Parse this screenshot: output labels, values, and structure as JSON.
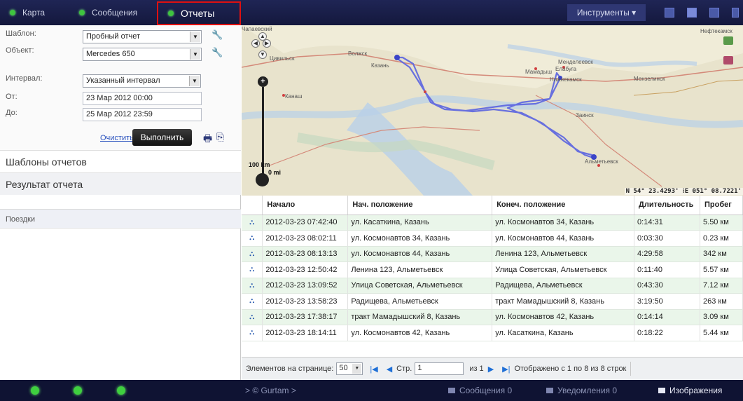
{
  "topbar": {
    "tabs": [
      {
        "label": "Карта"
      },
      {
        "label": "Сообщения"
      },
      {
        "label": "Отчеты"
      }
    ],
    "tools_label": "Инструменты ▾"
  },
  "form": {
    "template_label": "Шаблон:",
    "template_value": "Пробный отчет",
    "object_label": "Объект:",
    "object_value": "Mercedes 650",
    "interval_label": "Интервал:",
    "interval_value": "Указанный интервал",
    "from_label": "От:",
    "from_value": "23 Мар 2012 00:00",
    "to_label": "До:",
    "to_value": "25 Мар 2012 23:59",
    "clear_label": "Очистить",
    "run_label": "Выполнить"
  },
  "sections": {
    "templates": "Шаблоны отчетов",
    "result": "Результат отчета",
    "trips": "Поездки"
  },
  "map": {
    "cities": [
      "Чапаевский",
      "Цивильск",
      "Волжск",
      "Казань",
      "Менделеевск",
      "Мамадыш",
      "Елабуга",
      "Нижнекамск",
      "Мензелинск",
      "Нефтекамск",
      "Канаш",
      "Заинск",
      "Альметьевск"
    ],
    "scale_km": "100 km",
    "scale_mi": "0 mi",
    "coords": "N 54° 23.4293' ⁝E 051° 08.7221'"
  },
  "table": {
    "headers": [
      "Начало",
      "Нач. положение",
      "Конеч. положение",
      "Длительность",
      "Пробег"
    ],
    "rows": [
      [
        "2012-03-23 07:42:40",
        "ул. Касаткина, Казань",
        "ул. Космонавтов 34, Казань",
        "0:14:31",
        "5.50 км"
      ],
      [
        "2012-03-23 08:02:11",
        "ул. Космонавтов 34, Казань",
        "ул. Космонавтов 44, Казань",
        "0:03:30",
        "0.23 км"
      ],
      [
        "2012-03-23 08:13:13",
        "ул. Космонавтов 44, Казань",
        "Ленина 123, Альметьевск",
        "4:29:58",
        "342 км"
      ],
      [
        "2012-03-23 12:50:42",
        "Ленина 123, Альметьевск",
        "Улица Советская, Альметьевск",
        "0:11:40",
        "5.57 км"
      ],
      [
        "2012-03-23 13:09:52",
        "Улица Советская, Альметьевск",
        "Радищева, Альметьевск",
        "0:43:30",
        "7.12 км"
      ],
      [
        "2012-03-23 13:58:23",
        "Радищева, Альметьевск",
        "тракт Мамадышский 8, Казань",
        "3:19:50",
        "263 км"
      ],
      [
        "2012-03-23 17:38:17",
        "тракт Мамадышский 8, Казань",
        "ул. Космонавтов 42, Казань",
        "0:14:14",
        "3.09 км"
      ],
      [
        "2012-03-23 18:14:11",
        "ул. Космонавтов 42, Казань",
        "ул. Касаткина, Казань",
        "0:18:22",
        "5.44 км"
      ]
    ]
  },
  "pager": {
    "per_page_label": "Элементов на странице:",
    "per_page_value": "50",
    "page_label": "Стр.",
    "page_value": "1",
    "of_label": "из 1",
    "shown_label": "Отображено с 1 по 8 из 8 строк"
  },
  "bottombar": {
    "brand": "> © Gurtam >",
    "messages": "Сообщения 0",
    "notifications": "Уведомления 0",
    "images": "Изображения"
  },
  "colors": {
    "topbar": "#1a1f4a",
    "tab_highlight": "#e01010",
    "status_led": "#3fc43f",
    "row_alt": "#eaf6ea",
    "track": "#5a63e0"
  }
}
